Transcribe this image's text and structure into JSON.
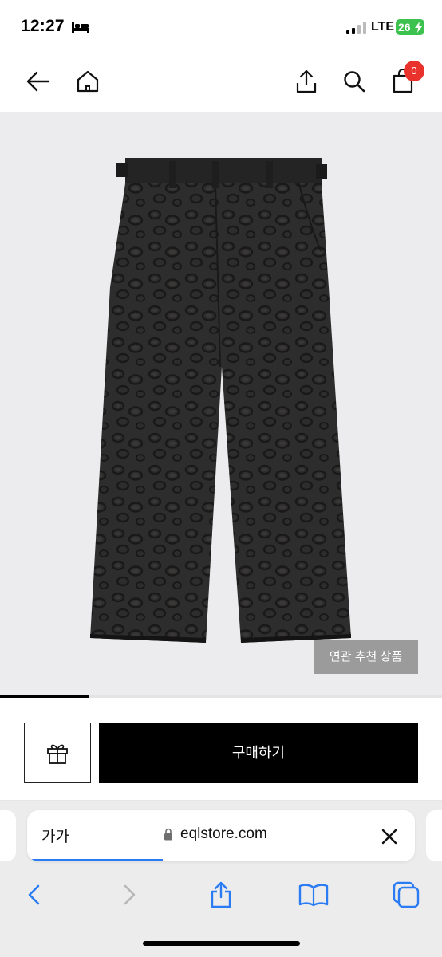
{
  "status_bar": {
    "time": "12:27",
    "network": "LTE",
    "battery": "26",
    "icons": [
      "bed-icon",
      "signal-icon",
      "battery-icon"
    ]
  },
  "header": {
    "icons": [
      "back-arrow-icon",
      "home-icon",
      "share-icon",
      "search-icon",
      "cart-icon"
    ],
    "cart_count": "0",
    "badge_color": "#e8322b"
  },
  "product": {
    "related_button": "연관 추천 상품",
    "image_progress": 0.2,
    "image_background": "#ececee"
  },
  "purchase": {
    "gift_icon": "gift-icon",
    "buy_label": "구매하기"
  },
  "browser": {
    "text_size_label": "가가",
    "url": "eqlstore.com",
    "load_progress": 0.35,
    "accent": "#2a7bf4",
    "toolbar_icons": [
      "back-icon",
      "forward-icon",
      "share-icon",
      "bookmarks-icon",
      "tabs-icon"
    ]
  }
}
